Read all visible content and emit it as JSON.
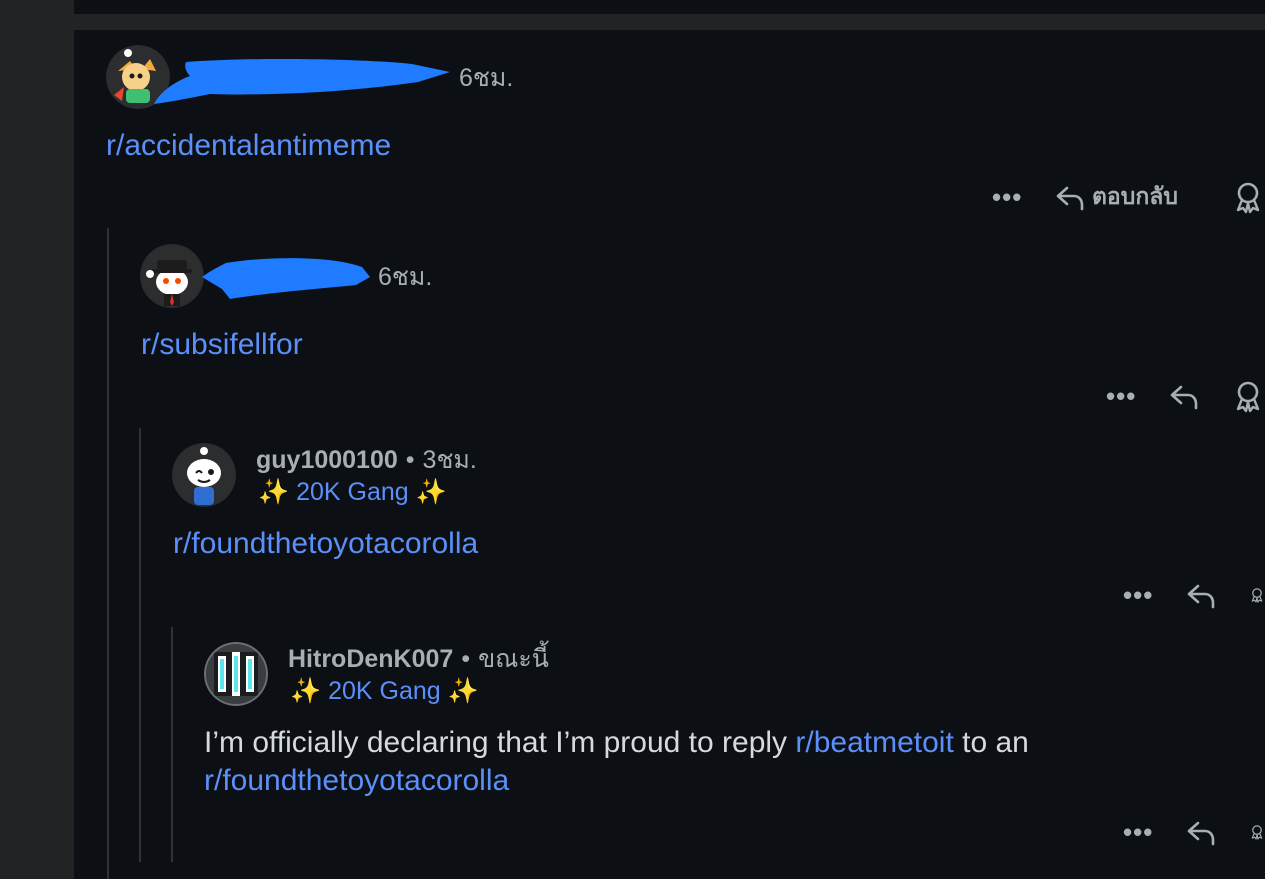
{
  "comments": [
    {
      "username": "",
      "time": "6ชม.",
      "flair": "",
      "link_text": "r/accidentalantimeme",
      "reply_label": "ตอบกลับ"
    },
    {
      "username": "",
      "time": "6ชม.",
      "flair": "",
      "link_text": "r/subsifellfor",
      "reply_label": ""
    },
    {
      "username": "guy1000100",
      "time": "3ชม.",
      "flair": "✨ 20K Gang ✨",
      "link_text": "r/foundthetoyotacorolla",
      "reply_label": ""
    },
    {
      "username": "HitroDenK007",
      "time": "ขณะนี้",
      "flair": "✨ 20K Gang ✨",
      "text_before": "I’m officially declaring that I’m proud to reply ",
      "link1": "r/beatmetoit",
      "text_middle": " to an ",
      "link2": "r/foundthetoyotacorolla",
      "reply_label": ""
    }
  ],
  "icons": {
    "more": "more-options-icon",
    "reply": "reply-arrow-icon",
    "award": "award-icon"
  },
  "colors": {
    "background": "#0c1014",
    "link": "#5b8ff9",
    "muted": "#a8aeb3",
    "redaction": "#1f7bff"
  }
}
